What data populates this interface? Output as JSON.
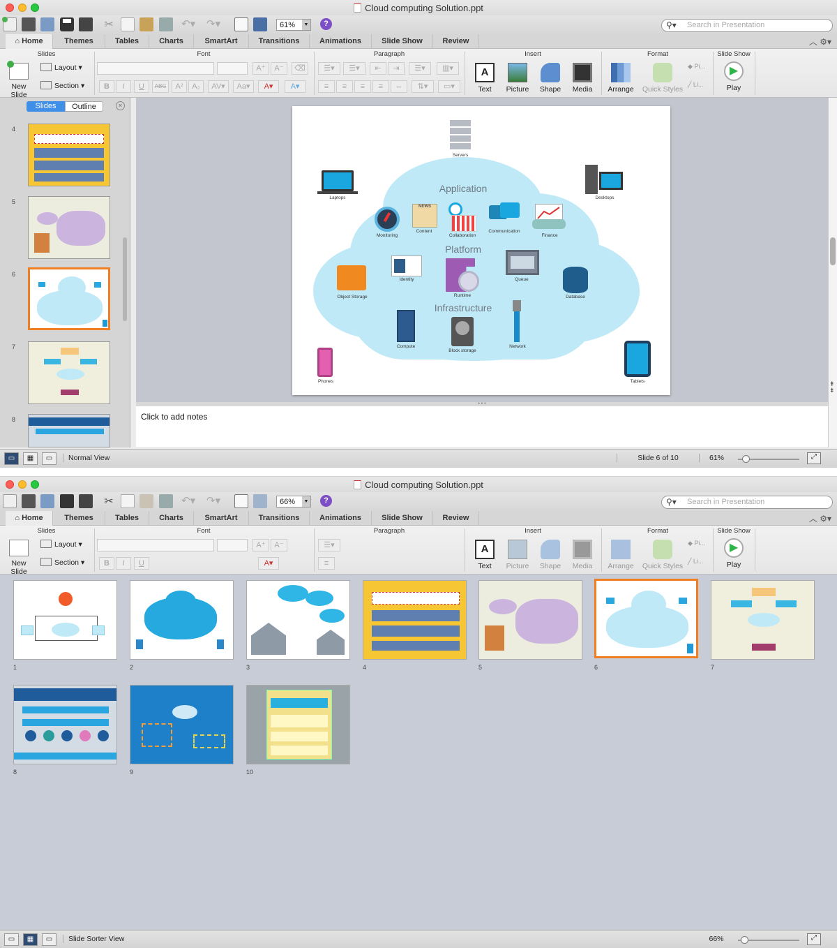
{
  "window1": {
    "title": "Cloud computing Solution.ppt",
    "zoom": "61%",
    "search_placeholder": "Search in Presentation",
    "tabs": [
      "Home",
      "Themes",
      "Tables",
      "Charts",
      "SmartArt",
      "Transitions",
      "Animations",
      "Slide Show",
      "Review"
    ],
    "ribbon": {
      "groups": [
        "Slides",
        "Font",
        "Paragraph",
        "Insert",
        "Format",
        "Slide Show"
      ],
      "new_slide": "New Slide",
      "layout": "Layout",
      "section": "Section",
      "insert_buttons": [
        "Text",
        "Picture",
        "Shape",
        "Media"
      ],
      "format_buttons": [
        "Arrange",
        "Quick Styles"
      ],
      "play": "Play",
      "format_mini": [
        "Pi...",
        "Li..."
      ]
    },
    "pane_tabs": {
      "slides": "Slides",
      "outline": "Outline"
    },
    "slide_numbers": [
      "4",
      "5",
      "6",
      "7",
      "8"
    ],
    "notes_placeholder": "Click to add notes",
    "status": {
      "view": "Normal View",
      "slide_position": "Slide 6 of 10",
      "zoom": "61%"
    }
  },
  "slide6": {
    "layers": [
      "Application",
      "Platform",
      "Infrastructure"
    ],
    "labels": {
      "servers": "Servers",
      "laptops": "Laptops",
      "desktops": "Desktops",
      "monitoring": "Monitoring",
      "content": "Content",
      "collaboration": "Collaboration",
      "communication": "Communication",
      "finance": "Finance",
      "identity": "Identity",
      "runtime": "Runtime",
      "queue": "Queue",
      "object_storage": "Object Storage",
      "database": "Database",
      "compute": "Compute",
      "block_storage": "Block storage",
      "network": "Network",
      "phones": "Phones",
      "tablets": "Tablets",
      "news": "NEWS"
    }
  },
  "window2": {
    "title": "Cloud computing Solution.ppt",
    "zoom": "66%",
    "search_placeholder": "Search in Presentation",
    "slide_numbers": [
      "1",
      "2",
      "3",
      "4",
      "5",
      "6",
      "7",
      "8",
      "9",
      "10"
    ],
    "status": {
      "view": "Slide Sorter View",
      "zoom": "66%"
    }
  },
  "colors": {
    "accent_orange": "#f07e22",
    "cloud": "#bfe9f7",
    "cloud_text": "#6f7a85"
  }
}
